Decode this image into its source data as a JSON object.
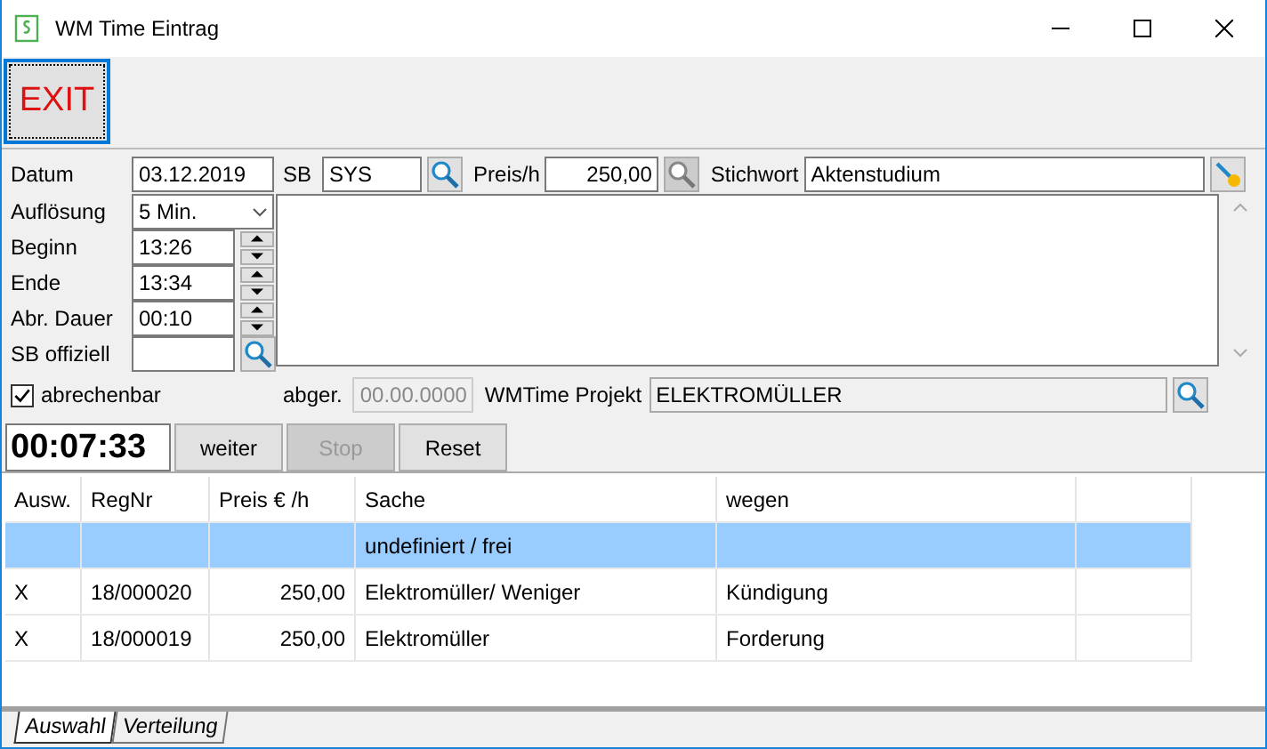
{
  "window": {
    "title": "WM Time Eintrag"
  },
  "toolbar": {
    "exit_button": "EXIT"
  },
  "form": {
    "datum": {
      "label": "Datum",
      "value": "03.12.2019"
    },
    "sb": {
      "label": "SB",
      "value": "SYS"
    },
    "preis": {
      "label": "Preis/h",
      "value": "250,00"
    },
    "stichwort": {
      "label": "Stichwort",
      "value": "Aktenstudium"
    },
    "aufloesung": {
      "label": "Auflösung",
      "value": "5 Min."
    },
    "beginn": {
      "label": "Beginn",
      "value": "13:26"
    },
    "ende": {
      "label": "Ende",
      "value": "13:34"
    },
    "abr_dauer": {
      "label": "Abr. Dauer",
      "value": "00:10"
    },
    "sb_offiziell": {
      "label": "SB offiziell"
    },
    "abrechenbar": {
      "label": "abrechenbar",
      "checked": true
    },
    "abger": {
      "label": "abger.",
      "value": "00.00.0000",
      "disabled": true
    },
    "projekt": {
      "label": "WMTime Projekt",
      "value": "ELEKTROMÜLLER",
      "readonly": true
    }
  },
  "timer": {
    "value": "00:07:33",
    "buttons": [
      {
        "label": "weiter",
        "disabled": false
      },
      {
        "label": "Stop",
        "disabled": true
      },
      {
        "label": "Reset",
        "disabled": false
      }
    ]
  },
  "table": {
    "columns": [
      "Ausw.",
      "RegNr",
      "Preis € /h",
      "Sache",
      "wegen"
    ],
    "rows": [
      {
        "sache": "undefiniert / frei",
        "selected": true
      },
      {
        "ausw": "X",
        "regnr": "18/000020",
        "preis": "250,00",
        "sache": "Elektromüller/ Weniger",
        "wegen": "Kündigung",
        "selected": false
      },
      {
        "ausw": "X",
        "regnr": "18/000019",
        "preis": "250,00",
        "sache": "Elektromüller",
        "wegen": "Forderung",
        "selected": false
      }
    ]
  },
  "tabs": [
    {
      "label": "Auswahl",
      "selected": true
    },
    {
      "label": "Verteilung",
      "selected": false
    }
  ]
}
